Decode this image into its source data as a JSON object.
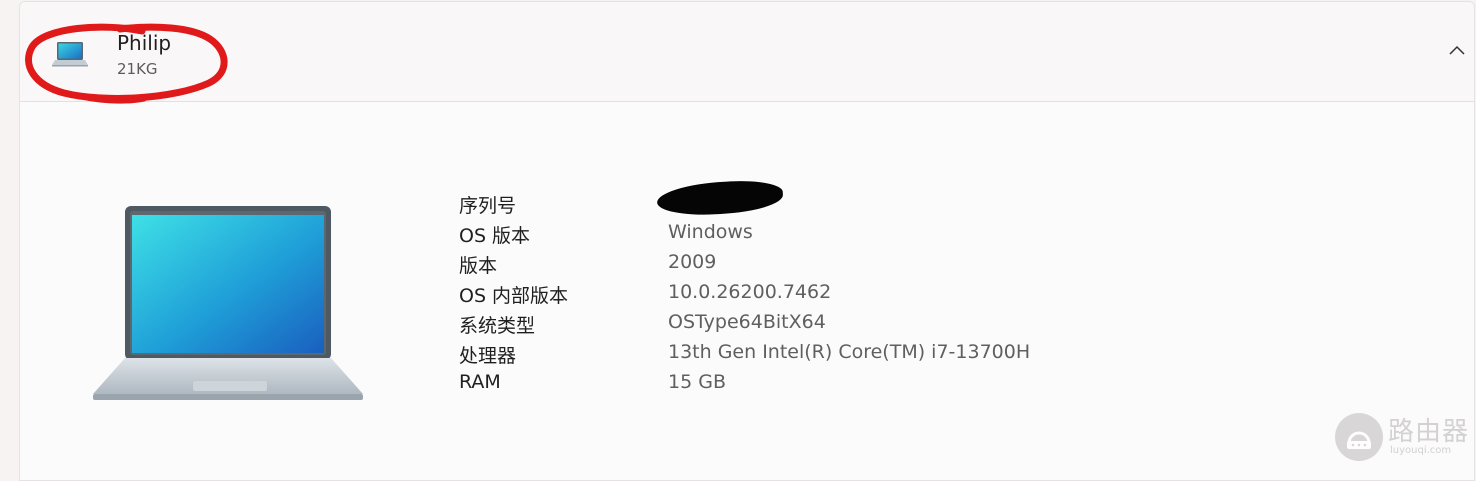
{
  "device": {
    "name": "Philip",
    "subtitle": "21KG",
    "expanded": true
  },
  "specs": [
    {
      "label": "序列号",
      "value": ""
    },
    {
      "label": "OS 版本",
      "value": "Windows"
    },
    {
      "label": "版本",
      "value": "2009"
    },
    {
      "label": "OS 内部版本",
      "value": "10.0.26200.7462"
    },
    {
      "label": "系统类型",
      "value": "OSType64BitX64"
    },
    {
      "label": "处理器",
      "value": "13th Gen Intel(R) Core(TM) i7-13700H"
    },
    {
      "label": "RAM",
      "value": "15 GB"
    }
  ],
  "icons": {
    "device": "laptop-icon",
    "expand": "chevron-up-icon"
  },
  "watermark": {
    "text": "路由器",
    "subtext": "luyouqi.com"
  },
  "colors": {
    "annotation": "#e0191b",
    "laptop_screen_top": "#3ad6e3",
    "laptop_screen_bottom": "#1b6fc4"
  }
}
